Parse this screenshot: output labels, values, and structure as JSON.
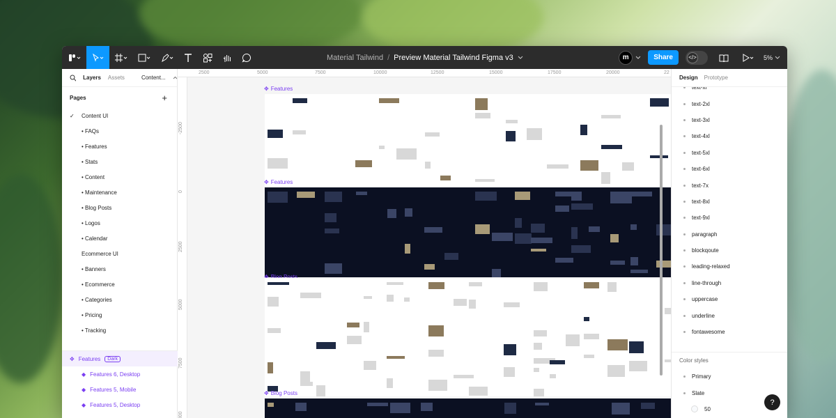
{
  "toolbar": {
    "project": "Material Tailwind",
    "separator": "/",
    "file": "Preview Material Tailwind Figma v3",
    "avatar_initial": "m",
    "share_label": "Share",
    "zoom": "5%",
    "dev_mode_glyph": "</>"
  },
  "left_panel": {
    "tab_layers": "Layers",
    "tab_assets": "Assets",
    "page_switch": "Content...",
    "pages_header": "Pages",
    "add_glyph": "+",
    "pages": [
      "Content UI",
      "• FAQs",
      "• Features",
      "• Stats",
      "• Content",
      "• Maintenance",
      "• Blog Posts",
      "• Logos",
      "• Calendar",
      "Ecommerce UI",
      "• Banners",
      "• Ecommerce",
      "• Categories",
      "• Pricing",
      "• Tracking"
    ],
    "layers": {
      "main": "Features",
      "main_badge": "Dark",
      "children": [
        "Features 6, Desktop",
        "Features 5, Mobile",
        "Features 5, Desktop"
      ]
    }
  },
  "canvas": {
    "ruler_x": [
      "2500",
      "5000",
      "7500",
      "10000",
      "12500",
      "15000",
      "17500",
      "20000",
      "22"
    ],
    "ruler_y": [
      "-2500",
      "0",
      "2500",
      "5000",
      "7500",
      "10000"
    ],
    "frames": [
      "Features",
      "Features",
      "Blog Posts",
      "Blog Posts"
    ]
  },
  "right_panel": {
    "tab_design": "Design",
    "tab_prototype": "Prototype",
    "text_styles": [
      "text-xl",
      "text-2xl",
      "text-3xl",
      "text-4xl",
      "text-5xl",
      "text-6xl",
      "text-7x",
      "text-8xl",
      "text-9xl",
      "paragraph",
      "blockqoute",
      "leading-relaxed",
      "line-through",
      "uppercase",
      "underline",
      "fontawesome"
    ],
    "color_styles_header": "Color styles",
    "color_styles": [
      "Primary",
      "Slate"
    ],
    "color_sub": "50"
  },
  "help_label": "?",
  "colors": {
    "accent": "#0d99ff",
    "component_purple": "#7b3ff2",
    "toolbar": "#2c2c2c",
    "dark_frame": "#0b1022"
  }
}
